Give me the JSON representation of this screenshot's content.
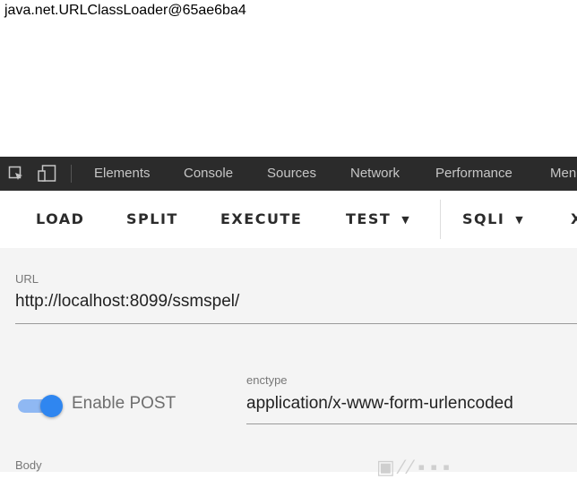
{
  "page_output": "java.net.URLClassLoader@65ae6ba4",
  "devtools": {
    "tabs": [
      "Elements",
      "Console",
      "Sources",
      "Network",
      "Performance",
      "Men"
    ],
    "icons": [
      "inspect-element-icon",
      "device-toolbar-icon"
    ]
  },
  "hackbar": {
    "buttons": [
      {
        "label": "LOAD"
      },
      {
        "label": "SPLIT"
      },
      {
        "label": "EXECUTE"
      },
      {
        "label": "TEST",
        "caret": "▼"
      },
      {
        "label": "SQLI",
        "caret": "▼"
      },
      {
        "label": "X"
      }
    ]
  },
  "form": {
    "url_label": "URL",
    "url_value": "http://localhost:8099/ssmspel/",
    "enable_post_label": "Enable POST",
    "enable_post_on": true,
    "enctype_label": "enctype",
    "enctype_value": "application/x-www-form-urlencoded",
    "body_label": "Body"
  },
  "colors": {
    "devtools_bg": "#2b2b2b",
    "toggle_accent": "#2f86f0",
    "form_bg": "#f4f4f4"
  }
}
